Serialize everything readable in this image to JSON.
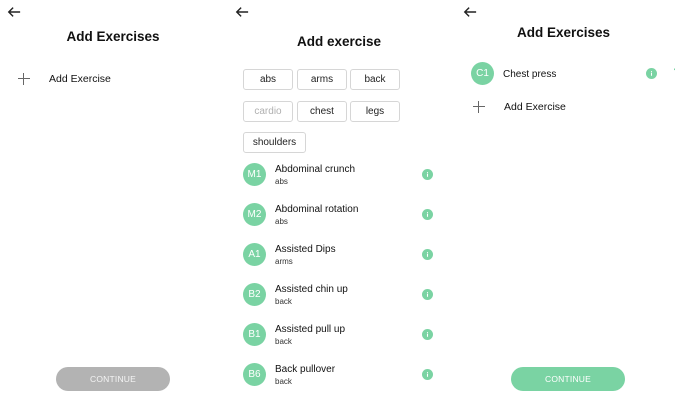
{
  "colors": {
    "accent": "#7ad3a3",
    "disabled": "#b3b3b3"
  },
  "screen1": {
    "back_icon": "arrow-left-icon",
    "title": "Add Exercises",
    "add_label": "Add Exercise",
    "continue_label": "CONTINUE",
    "continue_state": "disabled"
  },
  "screen2": {
    "back_icon": "arrow-left-icon",
    "title": "Add exercise",
    "chips": [
      {
        "label": "abs"
      },
      {
        "label": "arms"
      },
      {
        "label": "back"
      },
      {
        "label": "cardio"
      },
      {
        "label": "chest"
      },
      {
        "label": "legs"
      },
      {
        "label": "shoulders"
      }
    ],
    "exercises": [
      {
        "avatar": "M1",
        "name": "Abdominal crunch",
        "category": "abs"
      },
      {
        "avatar": "M2",
        "name": "Abdominal rotation",
        "category": "abs"
      },
      {
        "avatar": "A1",
        "name": "Assisted Dips",
        "category": "arms"
      },
      {
        "avatar": "B2",
        "name": "Assisted chin up",
        "category": "back"
      },
      {
        "avatar": "B1",
        "name": "Assisted pull up",
        "category": "back"
      },
      {
        "avatar": "B6",
        "name": "Back pullover",
        "category": "back"
      }
    ]
  },
  "screen3": {
    "back_icon": "arrow-left-icon",
    "title": "Add Exercises",
    "selected": [
      {
        "avatar": "C1",
        "name": "Chest press"
      }
    ],
    "add_label": "Add Exercise",
    "continue_label": "CONTINUE",
    "continue_state": "enabled"
  }
}
